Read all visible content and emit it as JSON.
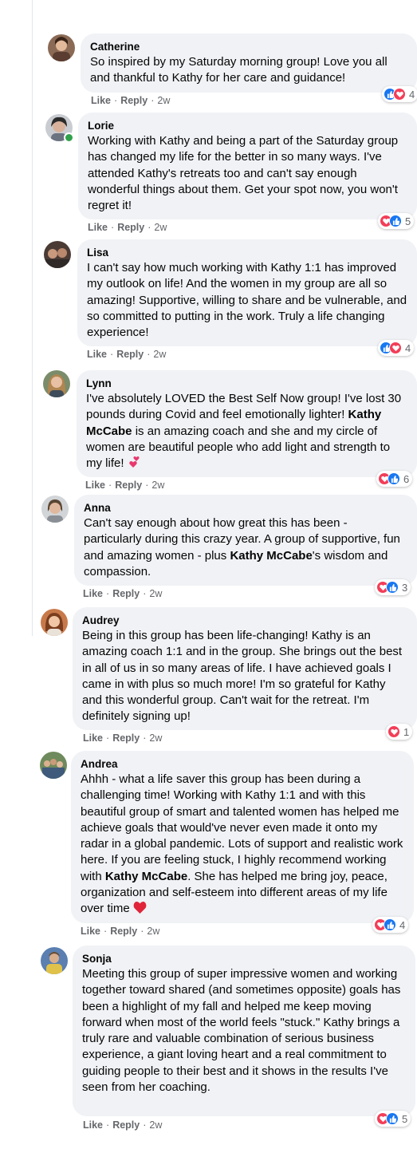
{
  "actions": {
    "like": "Like",
    "reply": "Reply",
    "sep": "·"
  },
  "colors": {
    "bubble": "#f0f2f5",
    "like": "#1877f2",
    "love": "#f33e58",
    "meta": "#65676b",
    "online": "#31a24c"
  },
  "comments": [
    {
      "author": "Catherine",
      "text": "So inspired by my Saturday morning group! Love you all and thankful to Kathy for her care and guidance!",
      "time": "2w",
      "reaction_count": "4",
      "reactions": [
        "like-icon",
        "love-icon"
      ]
    },
    {
      "author": "Lorie",
      "text": "Working with Kathy and being a part of the Saturday group has changed my life for the better in so many ways. I've attended Kathy's retreats too and can't say enough wonderful things about them. Get your spot now, you won't regret it!",
      "time": "2w",
      "reaction_count": "5",
      "reactions": [
        "love-icon",
        "like-icon"
      ]
    },
    {
      "author": "Lisa",
      "text": "I can't say how much working with Kathy 1:1 has improved my outlook on life! And the women in my group are all so amazing! Supportive, willing to share and be vulnerable, and so committed to putting in the work. Truly a life changing experience!",
      "time": "2w",
      "reaction_count": "4",
      "reactions": [
        "like-icon",
        "love-icon"
      ]
    },
    {
      "author": "Lynn",
      "text_before": "I've absolutely LOVED the Best Self Now group! I've lost 30 pounds during Covid and feel emotionally lighter! ",
      "text_bold": "Kathy McCabe",
      "text_after": " is an amazing coach and she and my circle of women are beautiful people who add light and strength to my life! ",
      "emoji": "two-hearts-emoji",
      "time": "2w",
      "reaction_count": "6",
      "reactions": [
        "love-icon",
        "like-icon"
      ]
    },
    {
      "author": "Anna",
      "text_before": "Can't say enough about how great this has been - particularly during this crazy year. A group of supportive, fun and amazing women - plus ",
      "text_bold": "Kathy McCabe",
      "text_after": "'s wisdom and compassion.",
      "time": "2w",
      "reaction_count": "3",
      "reactions": [
        "love-icon",
        "like-icon"
      ]
    },
    {
      "author": "Audrey",
      "text": "Being in this group has been life-changing! Kathy is an amazing coach 1:1 and in the group. She brings out the best in all of us in so many areas of life. I have achieved goals I came in with plus so much more! I'm so grateful for Kathy and this wonderful group. Can't wait for the retreat. I'm definitely signing up!",
      "time": "2w",
      "reaction_count": "1",
      "reactions": [
        "love-icon"
      ]
    },
    {
      "author": "Andrea",
      "text_before": "Ahhh - what a life saver this group has been during a challenging time! Working with Kathy 1:1 and with this beautiful group of smart and talented women has helped me achieve goals that would've never even made it onto my radar in a global pandemic. Lots of support and realistic work here. If you are feeling stuck, I highly recommend working with ",
      "text_bold": "Kathy McCabe",
      "text_after": ". She has helped me bring joy, peace, organization and self-esteem into different areas of my life over time ",
      "emoji": "red-heart-emoji",
      "time": "2w",
      "reaction_count": "4",
      "reactions": [
        "love-icon",
        "like-icon"
      ]
    },
    {
      "author": "Sonja",
      "text": "Meeting this group of super impressive women and working together toward shared (and sometimes opposite) goals has been a highlight of my fall and helped me keep moving forward when most of the world feels \"stuck.\" Kathy brings a truly rare and valuable combination of serious business experience, a giant loving heart and a real commitment to guiding people to their best and it shows in the results I've seen from her coaching.",
      "time": "2w",
      "reaction_count": "5",
      "reactions": [
        "love-icon",
        "like-icon"
      ]
    }
  ]
}
